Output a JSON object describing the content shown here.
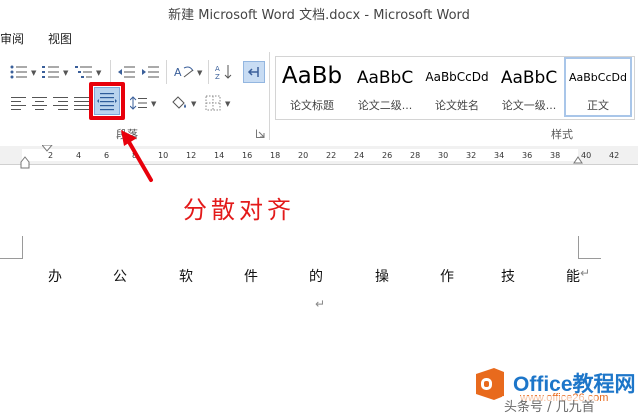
{
  "window": {
    "title": "新建 Microsoft Word 文档.docx - Microsoft Word"
  },
  "tabs": [
    {
      "label": "审阅"
    },
    {
      "label": "视图"
    }
  ],
  "ribbon": {
    "paragraph_group_label": "段落",
    "styles_group_label": "样式"
  },
  "styles": [
    {
      "sample": "AaBb",
      "name": "论文标题"
    },
    {
      "sample": "AaBbC",
      "name": "论文二级..."
    },
    {
      "sample": "AaBbCcDd",
      "name": "论文姓名"
    },
    {
      "sample": "AaBbC",
      "name": "论文一级..."
    },
    {
      "sample": "AaBbCcDd",
      "name": "正文"
    }
  ],
  "ruler": {
    "ticks": [
      "2",
      "4",
      "6",
      "8",
      "10",
      "12",
      "14",
      "16",
      "18",
      "20",
      "22",
      "24",
      "26",
      "28",
      "30",
      "32",
      "34",
      "36",
      "38",
      "40",
      "42"
    ]
  },
  "annotation": {
    "text": "分散对齐"
  },
  "document": {
    "chars": [
      "办",
      "公",
      "软",
      "件",
      "的",
      "操",
      "作",
      "技",
      "能"
    ]
  },
  "watermark": {
    "brand": "Office教程网",
    "url": "www.office26.com",
    "source": "头条号 / 几九首"
  },
  "colors": {
    "accent": "#e8000b",
    "ribbon_icon": "#3a5f9a",
    "highlight": "#b9d3ee"
  }
}
